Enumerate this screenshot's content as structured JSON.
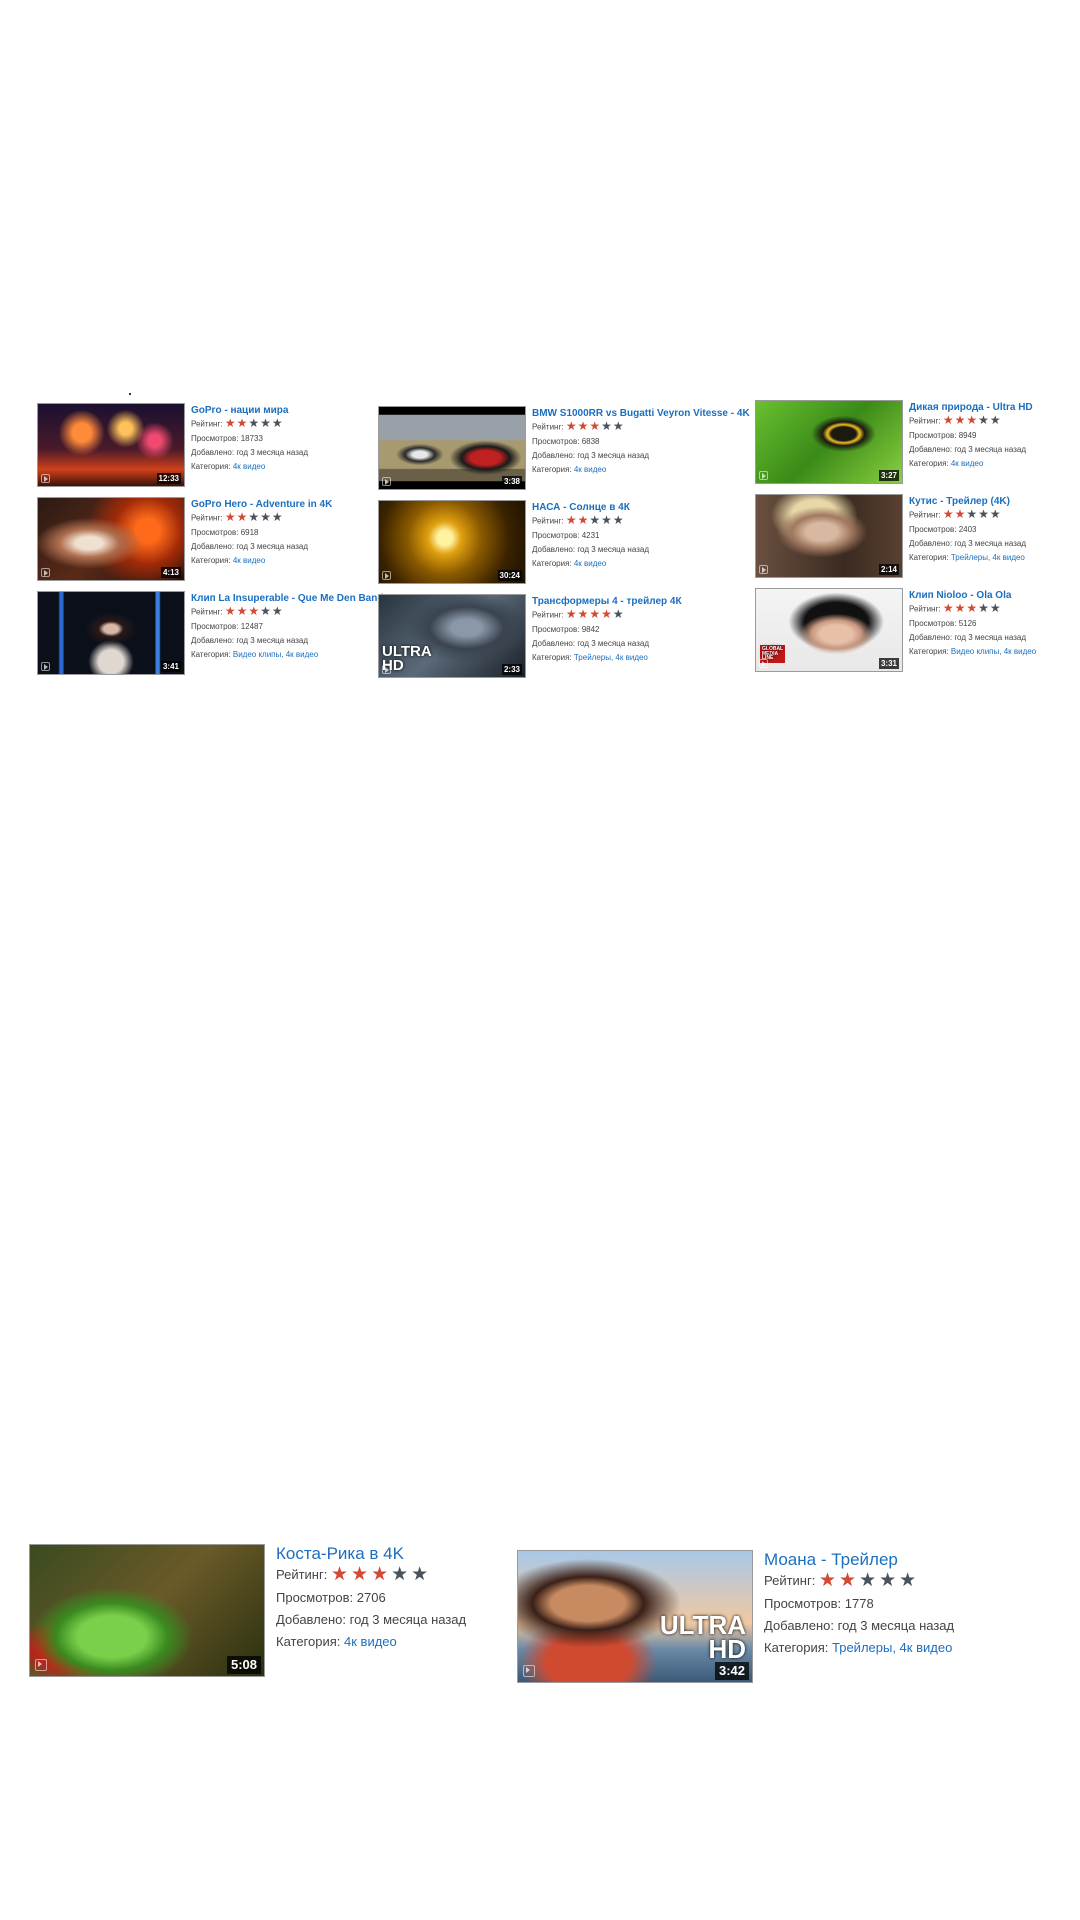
{
  "labels": {
    "rating": "Рейтинг:",
    "views": "Просмотров:",
    "added": "Добавлено:",
    "category": "Категория:"
  },
  "colors": {
    "link": "#1b6fc0",
    "star_on": "#d04a35",
    "star_off": "#4a525b"
  },
  "small_videos": [
    {
      "title": "GoPro - нации мира",
      "rating": 2,
      "views": "18733",
      "added": "год 3 месяца назад",
      "categories": "4к видео",
      "duration": "12:33",
      "thumb": "fireworks-volcano"
    },
    {
      "title": "GoPro Hero - Adventure in 4K",
      "rating": 2,
      "views": "6918",
      "added": "год 3 месяца назад",
      "categories": "4к видео",
      "duration": "4:13",
      "thumb": "lava-fire"
    },
    {
      "title": "Клип La Insuperable - Que Me Den Band",
      "rating": 3,
      "views": "12487",
      "added": "год 3 месяца назад",
      "categories": "Видео клипы, 4к видео",
      "duration": "3:41",
      "thumb": "singer-portrait"
    },
    {
      "title": "BMW S1000RR vs Bugatti Veyron Vitesse - 4K",
      "rating": 3,
      "views": "6838",
      "added": "год 3 месяца назад",
      "categories": "4к видео",
      "duration": "3:38",
      "thumb": "motorbike-vs-car"
    },
    {
      "title": "НАСА - Солнце в 4К",
      "rating": 2,
      "views": "4231",
      "added": "год 3 месяца назад",
      "categories": "4к видео",
      "duration": "30:24",
      "thumb": "sun-surface"
    },
    {
      "title": "Трансформеры 4 - трейлер 4К",
      "rating": 4,
      "views": "9842",
      "added": "год 3 месяца назад",
      "categories": "Трейлеры, 4к видео",
      "duration": "2:33",
      "thumb": "robot-ultra-hd",
      "overlay": "ULTRA\nHD"
    },
    {
      "title": "Дикая природа - Ultra HD",
      "rating": 3,
      "views": "8949",
      "added": "год 3 месяца назад",
      "categories": "4к видео",
      "duration": "3:27",
      "thumb": "toucan-bird"
    },
    {
      "title": "Кутис - Трейлер (4K)",
      "rating": 2,
      "views": "2403",
      "added": "год 3 месяца назад",
      "categories": "Трейлеры, 4к видео",
      "duration": "2:14",
      "thumb": "zombie-girl"
    },
    {
      "title": "Клип Nioloo - Ola Ola",
      "rating": 3,
      "views": "5126",
      "added": "год 3 месяца назад",
      "categories": "Видео клипы, 4к видео",
      "duration": "3:31",
      "thumb": "woman-bangs",
      "overlay": "GLOBAL\nMEDIA\nLINE"
    }
  ],
  "big_videos": [
    {
      "title": "Коста-Рика в 4K",
      "rating": 3,
      "views": "2706",
      "added": "год 3 месяца назад",
      "categories": "4к видео",
      "duration": "5:08",
      "thumb": "green-snake"
    },
    {
      "title": "Моана - Трейлер",
      "rating": 2,
      "views": "1778",
      "added": "год 3 месяца назад",
      "categories": "Трейлеры, 4к видео",
      "duration": "3:42",
      "thumb": "moana-ultra-hd",
      "overlay": "ULTRA\nHD"
    }
  ]
}
